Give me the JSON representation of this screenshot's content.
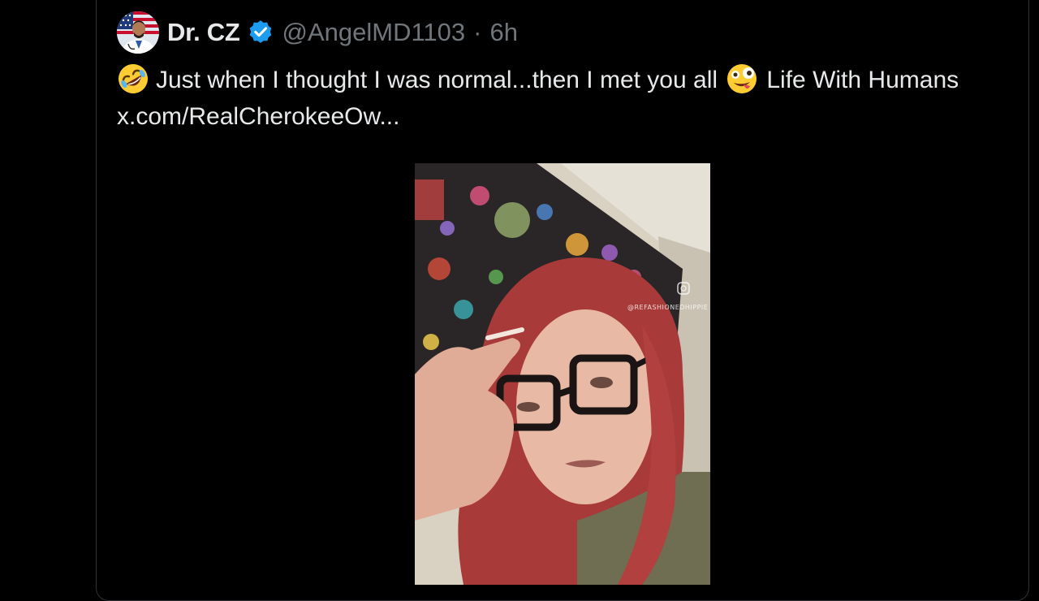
{
  "tweet": {
    "author": {
      "display_name": "Dr. CZ",
      "handle": "@AngelMD1103",
      "separator": "·",
      "time_ago": "6h",
      "verified": true,
      "avatar_icon": "doctor-avatar-with-us-flag"
    },
    "text": {
      "emoji_start": "rolling-on-floor-laughing-emoji",
      "part1": "Just when I thought I was normal...then I met you all",
      "emoji_mid": "zany-face-emoji",
      "part2": "Life With Humans",
      "link": "x.com/RealCherokeeOw..."
    },
    "media": {
      "type": "video-thumbnail",
      "watermark": "@REFASHIONEDHIPPIE"
    }
  },
  "colors": {
    "background": "#000000",
    "primary_text": "#e7e9ea",
    "secondary_text": "#71767b",
    "verified_blue": "#1d9bf0",
    "border": "#2f3336"
  }
}
